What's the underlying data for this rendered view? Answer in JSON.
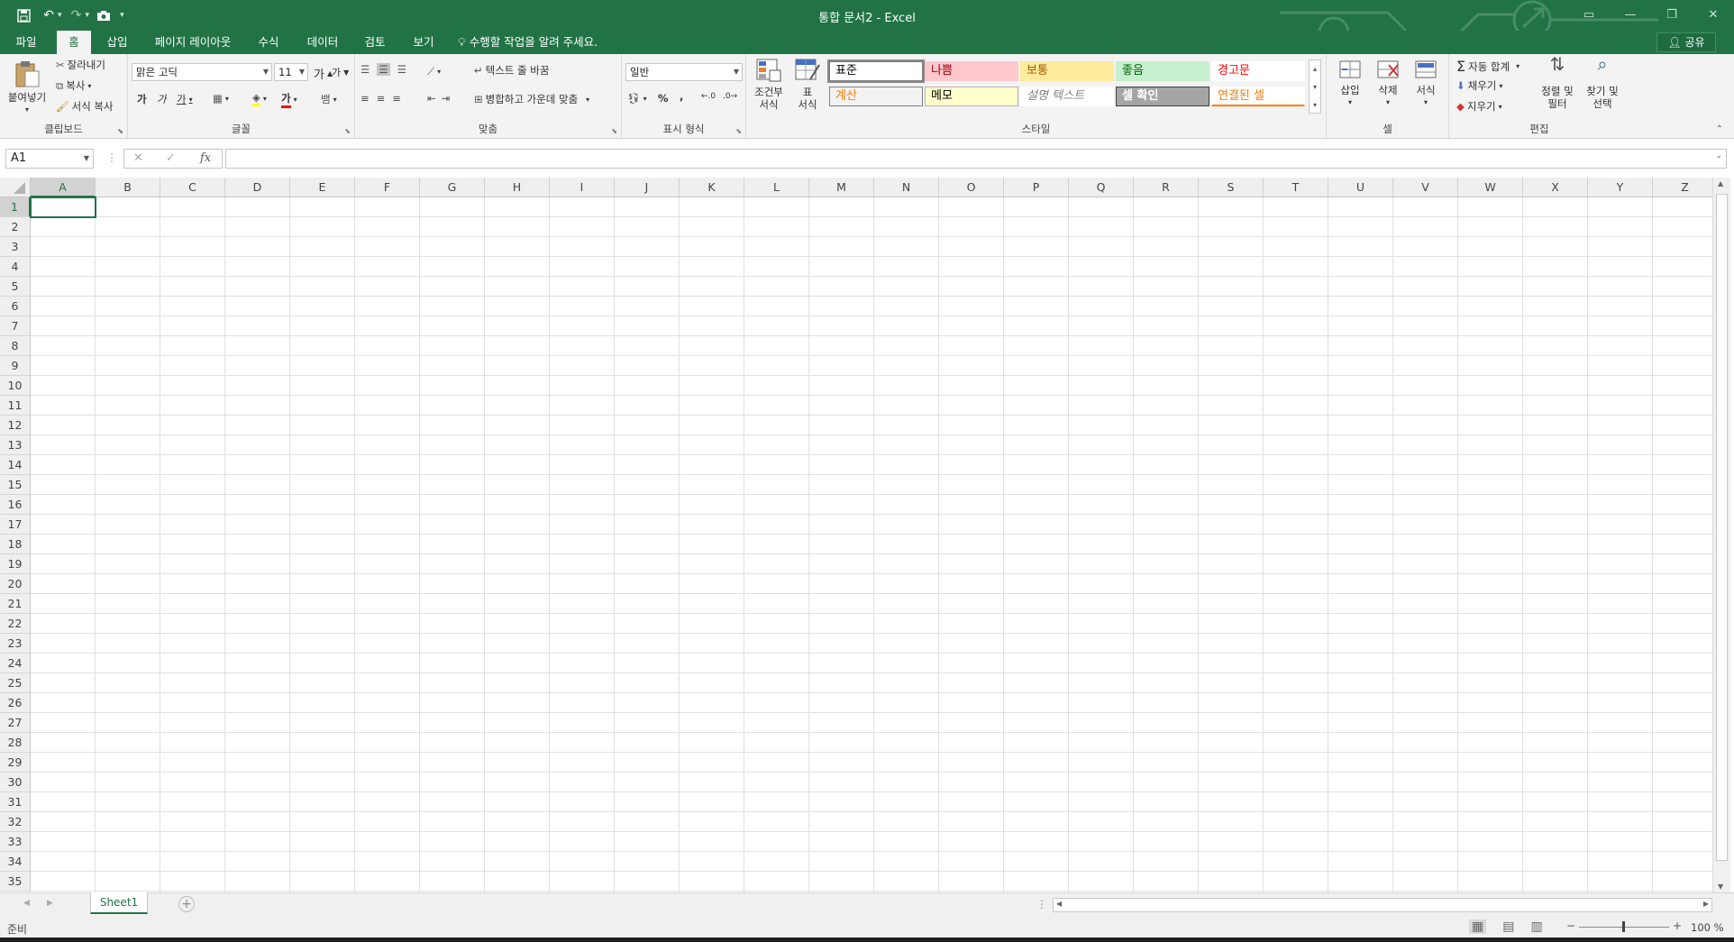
{
  "window": {
    "title": "통합 문서2 - Excel"
  },
  "menu": {
    "tabs": [
      "파일",
      "홈",
      "삽입",
      "페이지 레이아웃",
      "수식",
      "데이터",
      "검토",
      "보기"
    ],
    "active_tab": "홈",
    "tell_me": "수행할 작업을 알려 주세요.",
    "share": "공유"
  },
  "ribbon": {
    "clipboard": {
      "paste": "붙여넣기",
      "cut": "잘라내기",
      "copy": "복사",
      "format_painter": "서식 복사",
      "label": "클립보드"
    },
    "font": {
      "name": "맑은 고딕",
      "size": "11",
      "bold": "가",
      "italic": "가",
      "underline": "가",
      "label": "글꼴",
      "grow": "가",
      "shrink": "가",
      "text_color_glyph": "가",
      "phonetic": "뱀"
    },
    "alignment": {
      "wrap_text": "텍스트 줄 바꿈",
      "merge_center": "병합하고 가운데 맞춤",
      "label": "맞춤"
    },
    "number": {
      "format": "일반",
      "percent": "%",
      "comma": ",",
      "label": "표시 형식"
    },
    "styles": {
      "conditional": [
        "조건부",
        "서식"
      ],
      "table": [
        "표",
        "서식"
      ],
      "label": "스타일",
      "cells": [
        {
          "text": "표준",
          "bg": "#ffffff",
          "color": "#000000",
          "border": "#7a7a7a"
        },
        {
          "text": "나쁨",
          "bg": "#ffc7ce",
          "color": "#9c0006",
          "border": "#ffc7ce"
        },
        {
          "text": "보통",
          "bg": "#ffeb9c",
          "color": "#9c5700",
          "border": "#ffeb9c"
        },
        {
          "text": "좋음",
          "bg": "#c6efce",
          "color": "#006100",
          "border": "#c6efce"
        },
        {
          "text": "경고문",
          "bg": "#ffffff",
          "color": "#ff0000",
          "border": "#ffffff"
        },
        {
          "text": "계산",
          "bg": "#f2f2f2",
          "color": "#fa7d00",
          "border": "#7f7f7f"
        },
        {
          "text": "메모",
          "bg": "#ffffcc",
          "color": "#000000",
          "border": "#b2b2b2"
        },
        {
          "text": "설명 텍스트",
          "bg": "#ffffff",
          "color": "#7f7f7f",
          "border": "#ffffff"
        },
        {
          "text": "셀 확인",
          "bg": "#a5a5a5",
          "color": "#ffffff",
          "border": "#3f3f3f"
        },
        {
          "text": "연결된 셀",
          "bg": "#ffffff",
          "color": "#fa7d00",
          "border": "#ffffff"
        }
      ]
    },
    "cells": {
      "insert": "삽입",
      "delete": "삭제",
      "format": "서식",
      "label": "셀"
    },
    "editing": {
      "autosum": "자동 합계",
      "fill": "채우기",
      "clear": "지우기",
      "sort": [
        "정렬 및",
        "필터"
      ],
      "find": [
        "찾기 및",
        "선택"
      ],
      "label": "편집"
    }
  },
  "formula_bar": {
    "name_box": "A1",
    "fx": "fx",
    "value": ""
  },
  "grid": {
    "columns": [
      "A",
      "B",
      "C",
      "D",
      "E",
      "F",
      "G",
      "H",
      "I",
      "J",
      "K",
      "L",
      "M",
      "N",
      "O",
      "P",
      "Q",
      "R",
      "S",
      "T",
      "U",
      "V",
      "W",
      "X",
      "Y",
      "Z"
    ],
    "rows": [
      "1",
      "2",
      "3",
      "4",
      "5",
      "6",
      "7",
      "8",
      "9",
      "10",
      "11",
      "12",
      "13",
      "14",
      "15",
      "16",
      "17",
      "18",
      "19",
      "20",
      "21",
      "22",
      "23",
      "24",
      "25",
      "26",
      "27",
      "28",
      "29",
      "30",
      "31",
      "32",
      "33",
      "34",
      "35"
    ],
    "selected": "A1"
  },
  "sheets": {
    "tabs": [
      "Sheet1"
    ],
    "active": "Sheet1"
  },
  "status": {
    "ready": "준비",
    "zoom": "100 %"
  },
  "colors": {
    "accent": "#217346"
  }
}
